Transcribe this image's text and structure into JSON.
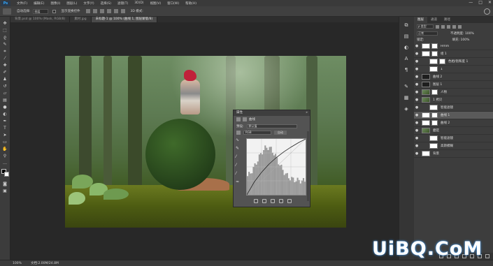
{
  "app": {
    "logo": "Ps",
    "menu": [
      "文件(F)",
      "编辑(E)",
      "图像(I)",
      "图层(L)",
      "文字(Y)",
      "选择(S)",
      "滤镜(T)",
      "3D(D)",
      "视图(V)",
      "窗口(W)",
      "帮助(H)"
    ],
    "window_controls": [
      "—",
      "□",
      "✕"
    ]
  },
  "options": {
    "auto_select_label": "自动选择:",
    "auto_select_value": "图层",
    "show_transform_label": "显示变换控件",
    "mode_3d_label": "3D 模式:"
  },
  "tabs": [
    {
      "label": "背景.psd @ 100% (Mask, RGB/8)",
      "active": false
    },
    {
      "label": "素材.jpg",
      "active": false
    },
    {
      "label": "未标题-1 @ 100% (曲线 1, 图层蒙版/8)",
      "active": true
    }
  ],
  "toolbar": {
    "icons": [
      "move-icon",
      "marquee-icon",
      "lasso-icon",
      "quick-select-icon",
      "crop-icon",
      "eyedropper-icon",
      "healing-icon",
      "brush-icon",
      "clone-stamp-icon",
      "history-brush-icon",
      "eraser-icon",
      "gradient-icon",
      "blur-icon",
      "dodge-icon",
      "pen-icon",
      "type-icon",
      "path-select-icon",
      "rectangle-icon",
      "hand-icon",
      "zoom-icon",
      "more-icon"
    ]
  },
  "properties_panel": {
    "title": "属性",
    "subtitle": "曲线",
    "preset_label": "预设:",
    "preset_value": "默认值",
    "channel_value": "RGB",
    "auto_label": "自动",
    "curve": {
      "input": [
        0,
        32,
        64,
        96,
        128,
        160,
        192,
        224,
        255
      ],
      "output": [
        0,
        58,
        103,
        140,
        170,
        196,
        218,
        238,
        255
      ]
    }
  },
  "layers_panel": {
    "tabs": [
      "图层",
      "通道",
      "路径"
    ],
    "kind_label": "ρ 类型",
    "blend_mode": "正常",
    "opacity_label": "不透明度: 100%",
    "lock_label": "锁定:",
    "fill_label": "填充: 100%",
    "rows": [
      {
        "name": "Hmm",
        "thumb": "white",
        "mask": true,
        "active": false,
        "indent": false
      },
      {
        "name": "组 1",
        "thumb": "white",
        "mask": true,
        "active": false,
        "indent": false
      },
      {
        "name": "色相/饱和度 1",
        "thumb": "white",
        "mask": true,
        "active": false,
        "indent": true
      },
      {
        "name": "1",
        "thumb": "white",
        "mask": false,
        "active": false,
        "indent": true
      },
      {
        "name": "曲线 2",
        "thumb": "dark",
        "mask": false,
        "active": false,
        "indent": false
      },
      {
        "name": "图层 1",
        "thumb": "dark",
        "mask": false,
        "active": false,
        "indent": false
      },
      {
        "name": "人物",
        "thumb": "photo",
        "mask": true,
        "active": false,
        "indent": false
      },
      {
        "name": "1 拷贝",
        "thumb": "photo",
        "mask": false,
        "active": false,
        "indent": false
      },
      {
        "name": "智能滤镜",
        "thumb": "white",
        "mask": false,
        "active": false,
        "indent": true
      },
      {
        "name": "曲线 1",
        "thumb": "white",
        "mask": true,
        "active": true,
        "indent": false
      },
      {
        "name": "曲线 2",
        "thumb": "white",
        "mask": true,
        "active": false,
        "indent": false
      },
      {
        "name": "蘑菇",
        "thumb": "photo",
        "mask": false,
        "active": false,
        "indent": false
      },
      {
        "name": "智能滤镜",
        "thumb": "white",
        "mask": false,
        "active": false,
        "indent": true
      },
      {
        "name": "高斯模糊",
        "thumb": "white",
        "mask": false,
        "active": false,
        "indent": true
      },
      {
        "name": "背景",
        "thumb": "white",
        "mask": false,
        "active": false,
        "indent": false
      }
    ]
  },
  "status": {
    "zoom": "100%",
    "doc_info": "文档:2.00M/24.8M"
  },
  "watermark": "UiBQ.CoM"
}
